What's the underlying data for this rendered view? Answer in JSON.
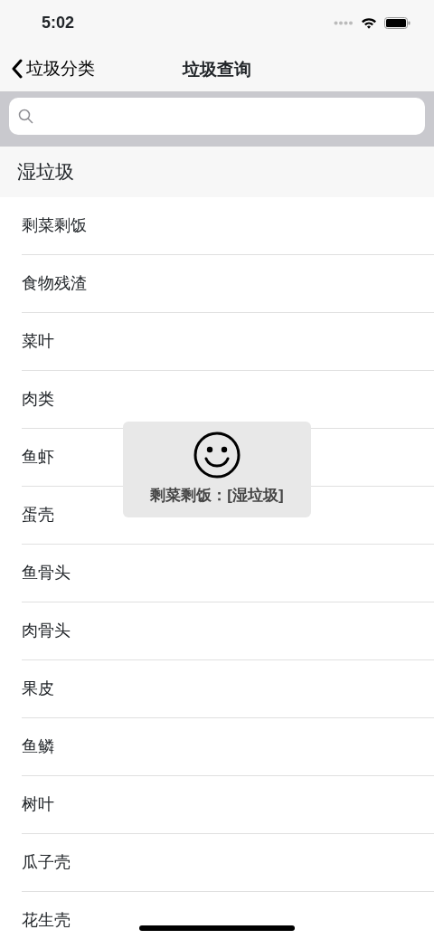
{
  "status_bar": {
    "time": "5:02"
  },
  "nav": {
    "back": "垃圾分类",
    "title": "垃圾查询"
  },
  "section": {
    "title": "湿垃圾"
  },
  "items": [
    "剩菜剩饭",
    "食物残渣",
    "菜叶",
    "肉类",
    "鱼虾",
    "蛋壳",
    "鱼骨头",
    "肉骨头",
    "果皮",
    "鱼鳞",
    "树叶",
    "瓜子壳",
    "花生壳"
  ],
  "toast": {
    "message": "剩菜剩饭：[湿垃圾]"
  }
}
